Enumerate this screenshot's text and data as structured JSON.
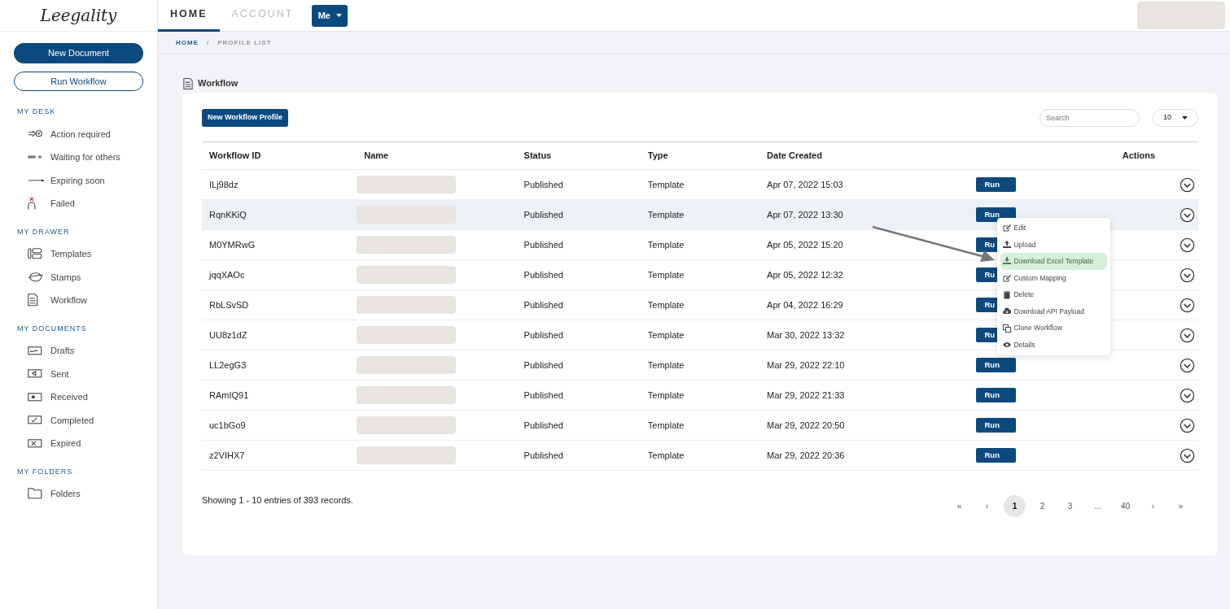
{
  "logo": {
    "text": "Leegality"
  },
  "top_tabs": [
    {
      "label": "HOME",
      "selected": true
    },
    {
      "label": "ACCOUNT",
      "selected": false
    }
  ],
  "user_menu": {
    "label": "Me"
  },
  "sidebar": {
    "buttons": [
      {
        "label": "New Document",
        "kind": "primary"
      },
      {
        "label": "Run Workflow",
        "kind": "outline"
      }
    ],
    "sections": [
      {
        "title": "MY DESK",
        "items": [
          {
            "label": "Action required",
            "kind": "action"
          },
          {
            "label": "Waiting for others",
            "kind": "waiting"
          },
          {
            "label": "Expiring soon",
            "kind": "expiring"
          },
          {
            "label": "Failed",
            "kind": "failed"
          }
        ]
      },
      {
        "title": "MY DRAWER",
        "items": [
          {
            "label": "Templates",
            "kind": "templates"
          },
          {
            "label": "Stamps",
            "kind": "stamps"
          },
          {
            "label": "Workflow",
            "kind": "workflow"
          }
        ]
      },
      {
        "title": "MY DOCUMENTS",
        "items": [
          {
            "label": "Drafts",
            "kind": "drafts"
          },
          {
            "label": "Sent",
            "kind": "sent"
          },
          {
            "label": "Received",
            "kind": "received"
          },
          {
            "label": "Completed",
            "kind": "completed"
          },
          {
            "label": "Expired",
            "kind": "expired"
          }
        ]
      },
      {
        "title": "MY FOLDERS",
        "items": [
          {
            "label": "Folders",
            "kind": "folders"
          }
        ]
      }
    ]
  },
  "breadcrumb": [
    {
      "label": "HOME",
      "kind": "link"
    },
    {
      "label": "/",
      "kind": "separator"
    },
    {
      "label": "PROFILE LIST",
      "kind": "current"
    }
  ],
  "page_title": "Workflow",
  "new_button": "New Workflow Profile",
  "search": {
    "placeholder": "Search"
  },
  "page_size": "10",
  "table": {
    "columns": [
      "Workflow ID",
      "Name",
      "Status",
      "Type",
      "Date Created",
      "Actions"
    ],
    "rows": [
      {
        "id": "ILj98dz",
        "status": "Published",
        "type": "Template",
        "date": "Apr 07, 2022 15:03",
        "run": "Run",
        "highlighted": false,
        "menu_open": false
      },
      {
        "id": "RqnKKiQ",
        "status": "Published",
        "type": "Template",
        "date": "Apr 07, 2022 13:30",
        "run": "Run",
        "highlighted": true,
        "menu_open": true
      },
      {
        "id": "M0YMRwG",
        "status": "Published",
        "type": "Template",
        "date": "Apr 05, 2022 15:20",
        "run": "Ru",
        "highlighted": false,
        "menu_open": false
      },
      {
        "id": "jqqXAOc",
        "status": "Published",
        "type": "Template",
        "date": "Apr 05, 2022 12:32",
        "run": "Ru",
        "highlighted": false,
        "menu_open": false
      },
      {
        "id": "RbLSvSD",
        "status": "Published",
        "type": "Template",
        "date": "Apr 04, 2022 16:29",
        "run": "Ru",
        "highlighted": false,
        "menu_open": false
      },
      {
        "id": "UU8z1dZ",
        "status": "Published",
        "type": "Template",
        "date": "Mar 30, 2022 13:32",
        "run": "Ru",
        "highlighted": false,
        "menu_open": false
      },
      {
        "id": "LL2egG3",
        "status": "Published",
        "type": "Template",
        "date": "Mar 29, 2022 22:10",
        "run": "Run",
        "highlighted": false,
        "menu_open": false
      },
      {
        "id": "RAmIQ91",
        "status": "Published",
        "type": "Template",
        "date": "Mar 29, 2022 21:33",
        "run": "Run",
        "highlighted": false,
        "menu_open": false
      },
      {
        "id": "uc1bGo9",
        "status": "Published",
        "type": "Template",
        "date": "Mar 29, 2022 20:50",
        "run": "Run",
        "highlighted": false,
        "menu_open": false
      },
      {
        "id": "z2VIHX7",
        "status": "Published",
        "type": "Template",
        "date": "Mar 29, 2022 20:36",
        "run": "Run",
        "highlighted": false,
        "menu_open": false
      }
    ]
  },
  "action_menu": [
    {
      "label": "Edit",
      "kind": "edit",
      "selected": false
    },
    {
      "label": "Upload",
      "kind": "upload",
      "selected": false
    },
    {
      "label": "Download Excel Template",
      "kind": "download",
      "selected": true
    },
    {
      "label": "Custom Mapping",
      "kind": "edit",
      "selected": false
    },
    {
      "label": "Delete",
      "kind": "delete",
      "selected": false
    },
    {
      "label": "Download API Payload",
      "kind": "cloud",
      "selected": false
    },
    {
      "label": "Clone Workflow",
      "kind": "clone",
      "selected": false
    },
    {
      "label": "Details",
      "kind": "eye",
      "selected": false
    }
  ],
  "summary": "Showing 1 - 10 entries of 393 records.",
  "pagination": [
    {
      "label": "«",
      "selected": false
    },
    {
      "label": "‹",
      "selected": false
    },
    {
      "label": "1",
      "selected": true
    },
    {
      "label": "2",
      "selected": false
    },
    {
      "label": "3",
      "selected": false
    },
    {
      "label": "...",
      "selected": false
    },
    {
      "label": "40",
      "selected": false
    },
    {
      "label": "›",
      "selected": false
    },
    {
      "label": "»",
      "selected": false
    }
  ]
}
